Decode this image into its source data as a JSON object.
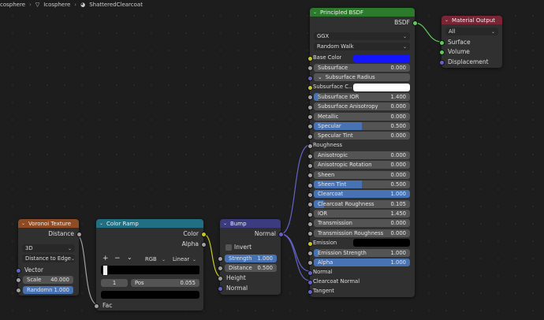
{
  "breadcrumbs": {
    "object": "cosphere",
    "mesh": "Icosphere",
    "material": "ShatteredClearcoat"
  },
  "colors": {
    "voronoi_header": "#8f4c24",
    "colorramp_header": "#216f82",
    "bump_header": "#3b3b80",
    "bsdf_header": "#2c7a2c",
    "output_header": "#7a2535",
    "base_color": "#1414ff",
    "subsurface_color": "#ffffff",
    "emission_color": "#000000"
  },
  "voronoi": {
    "title": "Voronoi Texture",
    "out_distance": "Distance",
    "dimension": "3D",
    "feature": "Distance to Edge",
    "in_vector": "Vector",
    "scale_label": "Scale",
    "scale_value": "40.000",
    "randomness_label": "Randomn",
    "randomness_value": "1.000",
    "randomness_fill": 1.0
  },
  "colorramp": {
    "title": "Color Ramp",
    "out_color": "Color",
    "out_alpha": "Alpha",
    "add": "+",
    "remove": "−",
    "menu": "⌄",
    "mode": "RGB",
    "interp": "Linear",
    "index": "1",
    "pos_label": "Pos",
    "pos_value": "0.055",
    "in_fac": "Fac"
  },
  "bump": {
    "title": "Bump",
    "out_normal": "Normal",
    "invert": "Invert",
    "strength_label": "Strength",
    "strength_value": "1.000",
    "strength_fill": 1.0,
    "distance_label": "Distance",
    "distance_value": "0.500",
    "in_height": "Height",
    "in_normal": "Normal"
  },
  "bsdf": {
    "title": "Principled BSDF",
    "out": "BSDF",
    "distribution": "GGX",
    "subsurface_method": "Random Walk",
    "rows": [
      {
        "label": "Base Color",
        "kind": "color",
        "sock": "yel"
      },
      {
        "label": "Subsurface",
        "value": "0.000",
        "fill": 0,
        "sock": "gray"
      },
      {
        "label": "Subsurface Radius",
        "kind": "vec",
        "sock": "pur"
      },
      {
        "label": "Subsurface C...",
        "kind": "color2",
        "sock": "yel"
      },
      {
        "label": "Subsurface IOR",
        "value": "1.400",
        "fill": 0.05,
        "sock": "gray"
      },
      {
        "label": "Subsurface Anisotropy",
        "value": "0.000",
        "fill": 0,
        "sock": "gray"
      },
      {
        "label": "Metallic",
        "value": "0.000",
        "fill": 0,
        "sock": "gray"
      },
      {
        "label": "Specular",
        "value": "0.500",
        "fill": 0.5,
        "sock": "gray"
      },
      {
        "label": "Specular Tint",
        "value": "0.000",
        "fill": 0,
        "sock": "gray"
      },
      {
        "label": "Roughness",
        "kind": "linked",
        "sock": "gray"
      },
      {
        "label": "Anisotropic",
        "value": "0.000",
        "fill": 0,
        "sock": "gray"
      },
      {
        "label": "Anisotropic Rotation",
        "value": "0.000",
        "fill": 0,
        "sock": "gray"
      },
      {
        "label": "Sheen",
        "value": "0.000",
        "fill": 0,
        "sock": "gray"
      },
      {
        "label": "Sheen Tint",
        "value": "0.500",
        "fill": 0.5,
        "sock": "gray"
      },
      {
        "label": "Clearcoat",
        "value": "1.000",
        "fill": 1,
        "sock": "gray"
      },
      {
        "label": "Clearcoat Roughness",
        "value": "0.105",
        "fill": 0.105,
        "sock": "gray"
      },
      {
        "label": "IOR",
        "value": "1.450",
        "fill": 0,
        "sock": "gray"
      },
      {
        "label": "Transmission",
        "value": "0.000",
        "fill": 0,
        "sock": "gray"
      },
      {
        "label": "Transmission Roughness",
        "value": "0.000",
        "fill": 0,
        "sock": "gray"
      },
      {
        "label": "Emission",
        "kind": "color3",
        "sock": "yel"
      },
      {
        "label": "Emission Strength",
        "value": "1.000",
        "fill": 0.05,
        "sock": "gray"
      },
      {
        "label": "Alpha",
        "value": "1.000",
        "fill": 1,
        "sock": "gray"
      },
      {
        "label": "Normal",
        "kind": "linked",
        "sock": "pur"
      },
      {
        "label": "Clearcoat Normal",
        "kind": "linked",
        "sock": "pur"
      },
      {
        "label": "Tangent",
        "kind": "linked",
        "sock": "pur"
      }
    ]
  },
  "output": {
    "title": "Material Output",
    "target": "All",
    "in_surface": "Surface",
    "in_volume": "Volume",
    "in_displacement": "Displacement"
  }
}
